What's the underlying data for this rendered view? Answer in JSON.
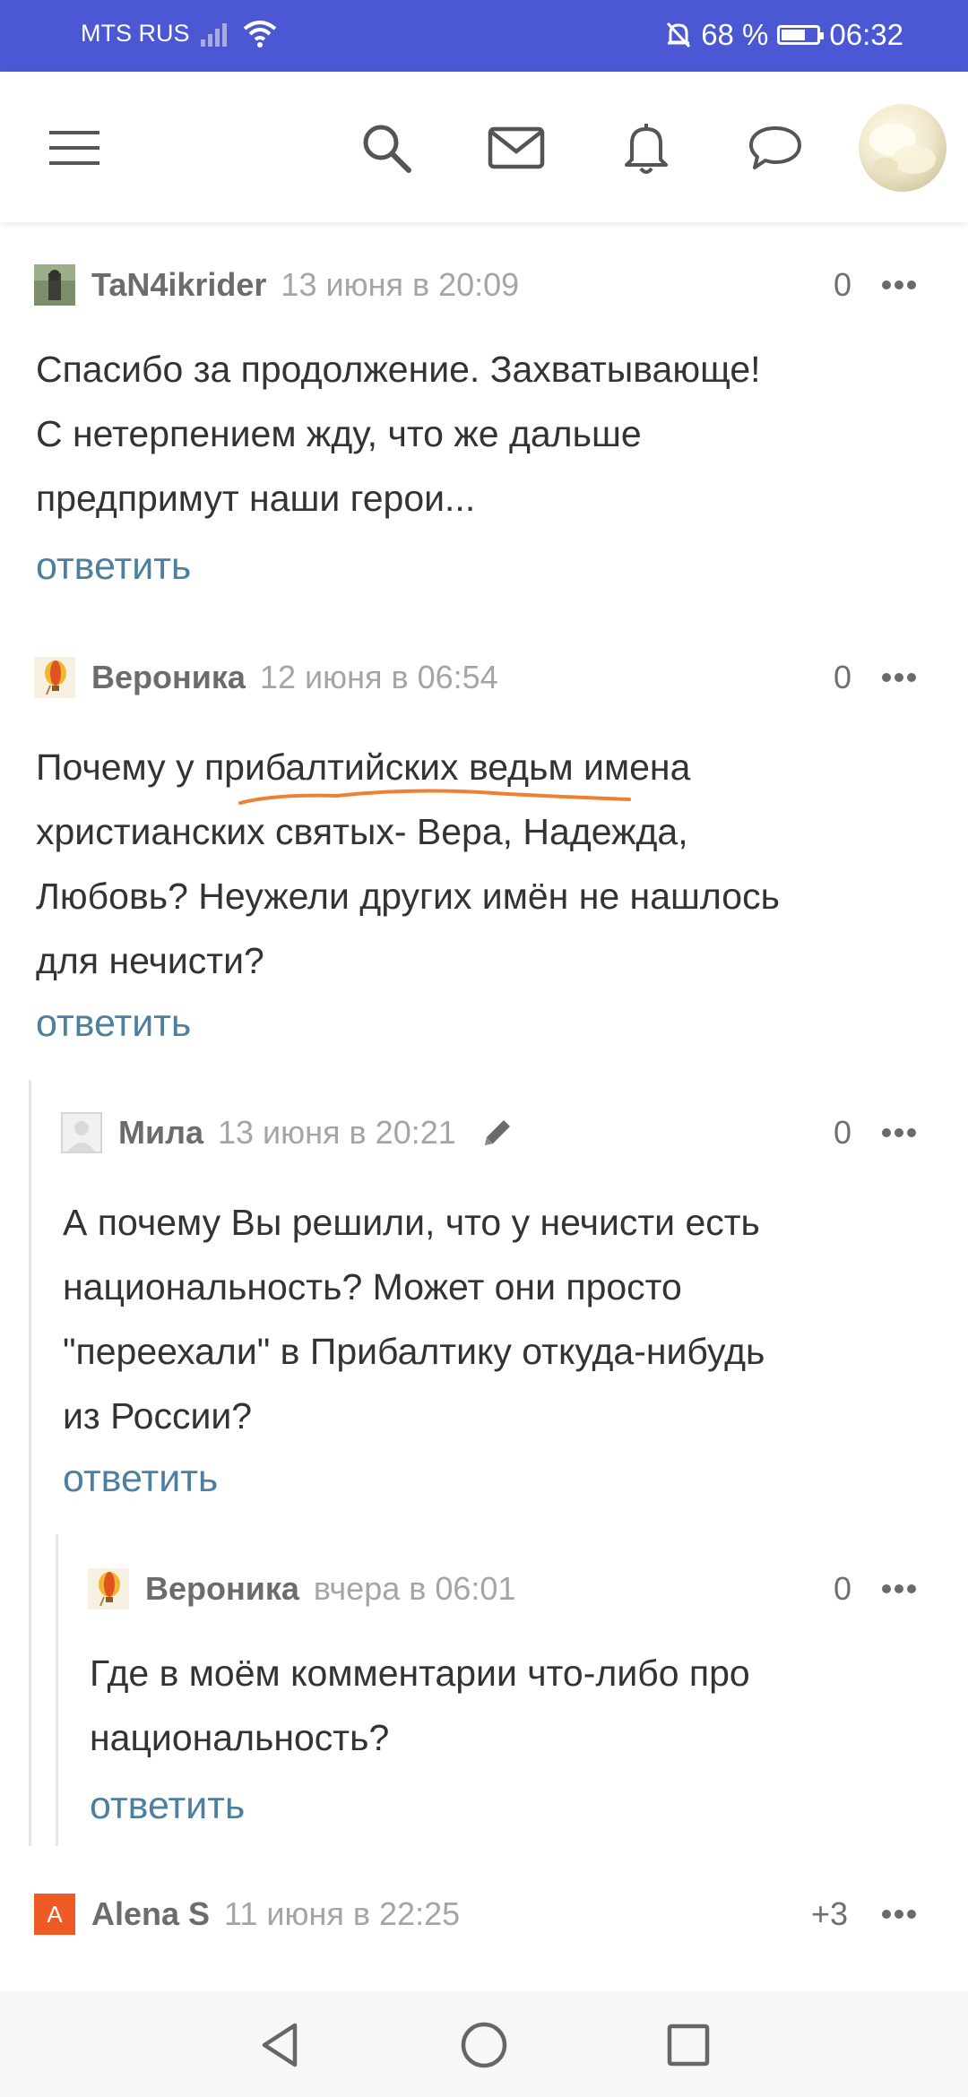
{
  "status_bar": {
    "carrier": "MTS RUS",
    "battery": "68 %",
    "battery_level": 0.68,
    "time": "06:32"
  },
  "nav": {
    "icons": [
      "menu-icon",
      "search-icon",
      "mail-icon",
      "bell-icon",
      "chat-icon",
      "avatar"
    ]
  },
  "comments": [
    {
      "author": "TaN4ikrider",
      "date": "13 июня в 20:09",
      "score": "0",
      "lines": [
        "Спасибо за продолжение. Захватывающе!",
        "С нетерпением жду, что же дальше",
        "предпримут наши герои..."
      ],
      "reply": "ответить"
    },
    {
      "author": "Вероника",
      "date": "12 июня в 06:54",
      "score": "0",
      "lines": [
        "Почему у прибалтийских ведьм имена",
        "христианских святых- Вера, Надежда,",
        "Любовь? Неужели других имён не нашлось",
        "для нечисти?"
      ],
      "reply": "ответить"
    },
    {
      "author": "Мила",
      "date": "13 июня в 20:21",
      "score": "0",
      "lines": [
        "А почему Вы решили, что у нечисти есть",
        "национальность? Может они просто",
        "\"переехали\" в Прибалтику откуда-нибудь",
        "из России?"
      ],
      "reply": "ответить"
    },
    {
      "author": "Вероника",
      "date": "вчера в 06:01",
      "score": "0",
      "lines": [
        "Где в моём комментарии что-либо про",
        "национальность?"
      ],
      "reply": "ответить"
    },
    {
      "author": "Alena S",
      "avatar_letter": "A",
      "date": "11 июня в 22:25",
      "score": "+3"
    }
  ],
  "colors": {
    "status_bar": "#4b57d3",
    "reply_link": "#4d7f9e",
    "underline_annotation": "#ee7f33",
    "alena_avatar": "#ef5a24"
  }
}
